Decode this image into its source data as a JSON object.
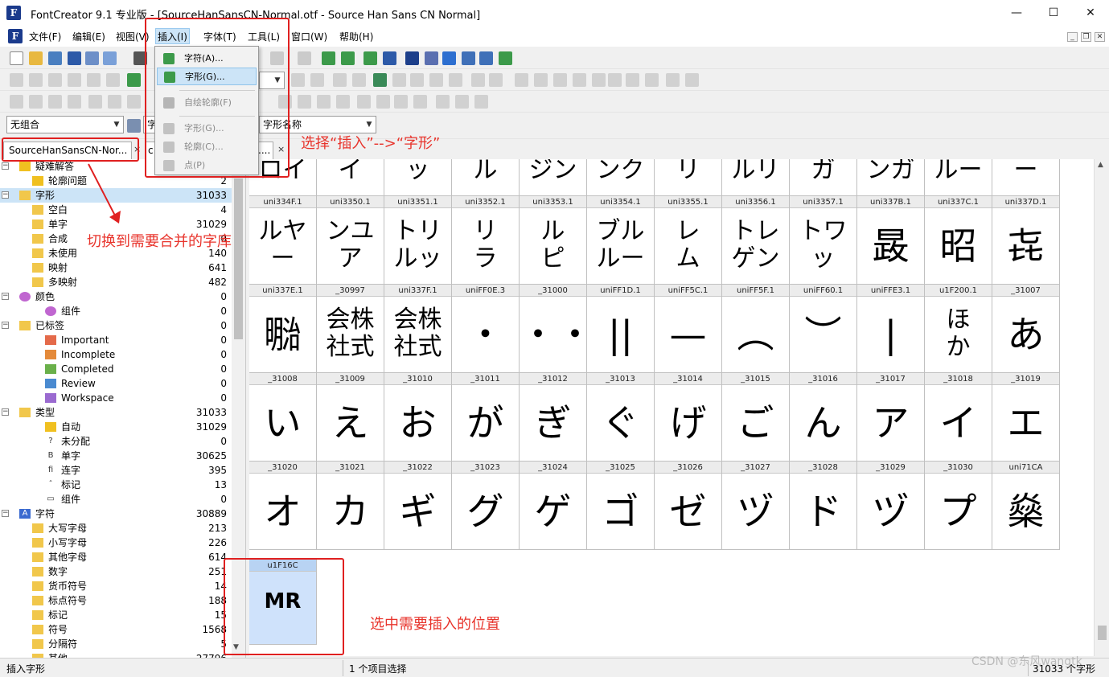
{
  "window": {
    "title": "FontCreator 9.1 专业版  - [SourceHanSansCN-Normal.otf - Source Han Sans CN Normal]",
    "icon_name": "fontcreator-icon",
    "controls": {
      "minimize": "—",
      "maximize": "☐",
      "close": "✕"
    }
  },
  "menubar": {
    "items": [
      "文件(F)",
      "编辑(E)",
      "视图(V)",
      "插入(I)",
      "字体(T)",
      "工具(L)",
      "窗口(W)",
      "帮助(H)"
    ],
    "active_index": 3,
    "mdi_controls": [
      "_",
      "❐",
      "✕"
    ]
  },
  "toolbar": {
    "composite_combo": "无组合",
    "partial_combo": "字",
    "glyph_name_combo": "字形名称"
  },
  "insert_menu": {
    "items": [
      {
        "label": "字符(A)...",
        "enabled": true,
        "hover": false,
        "icon": "add-character-icon"
      },
      {
        "label": "字形(G)...",
        "enabled": true,
        "hover": true,
        "icon": "add-glyph-icon"
      },
      {
        "label": "自绘轮廓(F)",
        "enabled": false,
        "hover": false,
        "icon": "freehand-contour-icon"
      },
      {
        "label": "字形(G)...",
        "enabled": false,
        "hover": false,
        "icon": "glyph-component-icon"
      },
      {
        "label": "轮廓(C)...",
        "enabled": false,
        "hover": false,
        "icon": "contour-icon"
      },
      {
        "label": "点(P)",
        "enabled": false,
        "hover": false,
        "icon": "point-icon"
      }
    ]
  },
  "tabs": [
    {
      "label": "SourceHanSansCN-Nor...",
      "close": "×"
    },
    {
      "label": "c",
      "close": ""
    },
    {
      "label": "....",
      "close": "×"
    }
  ],
  "tree": [
    {
      "label": "疑难解答",
      "count": "",
      "indent": 0,
      "icon": "warning-icon",
      "toggle": "-"
    },
    {
      "label": "轮廓问题",
      "count": "2",
      "indent": 1,
      "icon": "warning-icon",
      "toggle": ""
    },
    {
      "label": "字形",
      "count": "31033",
      "indent": 0,
      "icon": "folder-icon",
      "toggle": "-",
      "selected": true
    },
    {
      "label": "空白",
      "count": "4",
      "indent": 1,
      "icon": "folder-icon",
      "toggle": ""
    },
    {
      "label": "单字",
      "count": "31029",
      "indent": 1,
      "icon": "folder-icon",
      "toggle": ""
    },
    {
      "label": "合成",
      "count": "0",
      "indent": 1,
      "icon": "folder-icon",
      "toggle": ""
    },
    {
      "label": "未使用",
      "count": "140",
      "indent": 1,
      "icon": "folder-icon",
      "toggle": ""
    },
    {
      "label": "映射",
      "count": "641",
      "indent": 1,
      "icon": "folder-icon",
      "toggle": ""
    },
    {
      "label": "多映射",
      "count": "482",
      "indent": 1,
      "icon": "folder-icon",
      "toggle": ""
    },
    {
      "label": "颜色",
      "count": "0",
      "indent": 0,
      "icon": "color-wheel-icon",
      "toggle": "-"
    },
    {
      "label": "组件",
      "count": "0",
      "indent": 2,
      "icon": "color-wheel-icon",
      "toggle": ""
    },
    {
      "label": "已标签",
      "count": "0",
      "indent": 0,
      "icon": "folder-icon",
      "toggle": "-"
    },
    {
      "label": "Important",
      "count": "0",
      "indent": 2,
      "icon": "tag-important-icon",
      "toggle": ""
    },
    {
      "label": "Incomplete",
      "count": "0",
      "indent": 2,
      "icon": "tag-incomplete-icon",
      "toggle": ""
    },
    {
      "label": "Completed",
      "count": "0",
      "indent": 2,
      "icon": "tag-completed-icon",
      "toggle": ""
    },
    {
      "label": "Review",
      "count": "0",
      "indent": 2,
      "icon": "tag-review-icon",
      "toggle": ""
    },
    {
      "label": "Workspace",
      "count": "0",
      "indent": 2,
      "icon": "tag-workspace-icon",
      "toggle": ""
    },
    {
      "label": "类型",
      "count": "31033",
      "indent": 0,
      "icon": "folder-icon",
      "toggle": "-"
    },
    {
      "label": "自动",
      "count": "31029",
      "indent": 2,
      "icon": "lightning-icon",
      "toggle": ""
    },
    {
      "label": "未分配",
      "count": "0",
      "indent": 2,
      "icon": "question-mark-icon",
      "toggle": ""
    },
    {
      "label": "单字",
      "count": "30625",
      "indent": 2,
      "icon": "letter-b-icon",
      "toggle": ""
    },
    {
      "label": "连字",
      "count": "395",
      "indent": 2,
      "icon": "ligature-fi-icon",
      "toggle": ""
    },
    {
      "label": "标记",
      "count": "13",
      "indent": 2,
      "icon": "caret-mark-icon",
      "toggle": ""
    },
    {
      "label": "组件",
      "count": "0",
      "indent": 2,
      "icon": "component-box-icon",
      "toggle": ""
    },
    {
      "label": "字符",
      "count": "30889",
      "indent": 0,
      "icon": "letter-a-icon",
      "toggle": "-"
    },
    {
      "label": "大写字母",
      "count": "213",
      "indent": 1,
      "icon": "folder-icon",
      "toggle": ""
    },
    {
      "label": "小写字母",
      "count": "226",
      "indent": 1,
      "icon": "folder-icon",
      "toggle": ""
    },
    {
      "label": "其他字母",
      "count": "614",
      "indent": 1,
      "icon": "folder-icon",
      "toggle": ""
    },
    {
      "label": "数字",
      "count": "251",
      "indent": 1,
      "icon": "folder-icon",
      "toggle": ""
    },
    {
      "label": "货币符号",
      "count": "14",
      "indent": 1,
      "icon": "folder-icon",
      "toggle": ""
    },
    {
      "label": "标点符号",
      "count": "188",
      "indent": 1,
      "icon": "folder-icon",
      "toggle": ""
    },
    {
      "label": "标记",
      "count": "15",
      "indent": 1,
      "icon": "folder-icon",
      "toggle": ""
    },
    {
      "label": "符号",
      "count": "1568",
      "indent": 1,
      "icon": "folder-icon",
      "toggle": ""
    },
    {
      "label": "分隔符",
      "count": "5",
      "indent": 1,
      "icon": "folder-icon",
      "toggle": ""
    },
    {
      "label": "其他",
      "count": "27796",
      "indent": 1,
      "icon": "folder-icon",
      "toggle": ""
    }
  ],
  "glyph_grid": {
    "columns": 12,
    "rows": [
      {
        "names": [
          "",
          "",
          "",
          "",
          "",
          "",
          "",
          "",
          "",
          "",
          "",
          ""
        ],
        "glyphs": [
          "ネ\nロイ",
          "ル\nイ",
          "ハ\nッ",
          "ス\nル",
          "ョ\nジン",
          "ラ\nンク",
          "ミ\nリ",
          "ミ\nルリ",
          "ヘ\nガ",
          "ン\nンガ",
          "ス\nルー",
          "ー\nー"
        ]
      },
      {
        "names": [
          "uni334F.1",
          "uni3350.1",
          "uni3351.1",
          "uni3352.1",
          "uni3353.1",
          "uni3354.1",
          "uni3355.1",
          "uni3356.1",
          "uni3357.1",
          "uni337B.1",
          "uni337C.1",
          "uni337D.1"
        ],
        "glyphs": [
          "ルヤ\nー",
          "ンユ\nア",
          "トリ\nルッ",
          "リ\nラ",
          "ル\nピ",
          "ブル\nルー",
          "レ\nム",
          "トレ\nゲン",
          "トワ\nッ",
          "晸",
          "昭",
          "㐂"
        ]
      },
      {
        "names": [
          "uni337E.1",
          "_30997",
          "uni337F.1",
          "uniFF0E.3",
          "_31000",
          "uniFF1D.1",
          "uniFF5C.1",
          "uniFF5F.1",
          "uniFF60.1",
          "uniFFE3.1",
          "u1F200.1",
          "_31007"
        ],
        "glyphs": [
          "㍾",
          "会株\n社式",
          "会株\n社式",
          "・",
          "・・",
          "||",
          "—",
          "︵",
          "︶",
          "|",
          "ほ\nか",
          "あ"
        ]
      },
      {
        "names": [
          "_31008",
          "_31009",
          "_31010",
          "_31011",
          "_31012",
          "_31013",
          "_31014",
          "_31015",
          "_31016",
          "_31017",
          "_31018",
          "_31019"
        ],
        "glyphs": [
          "い",
          "え",
          "お",
          "が",
          "ぎ",
          "ぐ",
          "げ",
          "ご",
          "ん",
          "ア",
          "イ",
          "エ"
        ]
      },
      {
        "names": [
          "_31020",
          "_31021",
          "_31022",
          "_31023",
          "_31024",
          "_31025",
          "_31026",
          "_31027",
          "_31028",
          "_31029",
          "_31030",
          "uni71CA"
        ],
        "glyphs": [
          "オ",
          "カ",
          "ギ",
          "グ",
          "ゲ",
          "ゴ",
          "ゼ",
          "ヅ",
          "ド",
          "ヅ",
          "プ",
          "燊"
        ]
      }
    ],
    "selected_cell": {
      "name": "u1F16C",
      "glyph": "MR"
    }
  },
  "statusbar": {
    "left": "插入字形",
    "middle": "1 个项目选择",
    "right": "31033 个字形"
  },
  "annotations": {
    "select_menu": "选择“插入”-->“字形”",
    "switch_font": "切换到需要合并的字库",
    "select_position": "选中需要插入的位置",
    "color": "#e8342c"
  },
  "watermark": "CSDN @东风wangtk"
}
